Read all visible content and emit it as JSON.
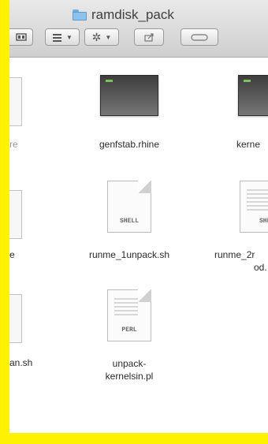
{
  "window": {
    "title": "ramdisk_pack",
    "title_icon": "folder-icon"
  },
  "toolbar": {
    "buttons": [
      {
        "icon": "view-icon"
      },
      {
        "icon": "arrange-icon"
      },
      {
        "icon": "gear-icon"
      },
      {
        "icon": "share-icon"
      },
      {
        "icon": "tags-icon"
      }
    ]
  },
  "files": {
    "row1": [
      {
        "name": "re",
        "kind": "generic"
      },
      {
        "name": "genfstab.rhine",
        "kind": "executable"
      },
      {
        "name": "kerne",
        "kind": "executable"
      }
    ],
    "row2": [
      {
        "name": "e",
        "kind": "generic"
      },
      {
        "name": "runme_1unpack.sh",
        "kind": "shell",
        "badge": "SHELL"
      },
      {
        "name_line1": "runme_2r",
        "name_line2": "od.",
        "kind": "shell",
        "badge": "SHE"
      }
    ],
    "row3": [
      {
        "name": "an.sh",
        "kind": "generic"
      },
      {
        "name_line1": "unpack-",
        "name_line2": "kernelsin.pl",
        "kind": "perl",
        "badge": "PERL"
      }
    ]
  },
  "colors": {
    "highlight_border": "#fff200",
    "terminal_prompt": "#79c35a",
    "folder": "#8cc2ec"
  }
}
